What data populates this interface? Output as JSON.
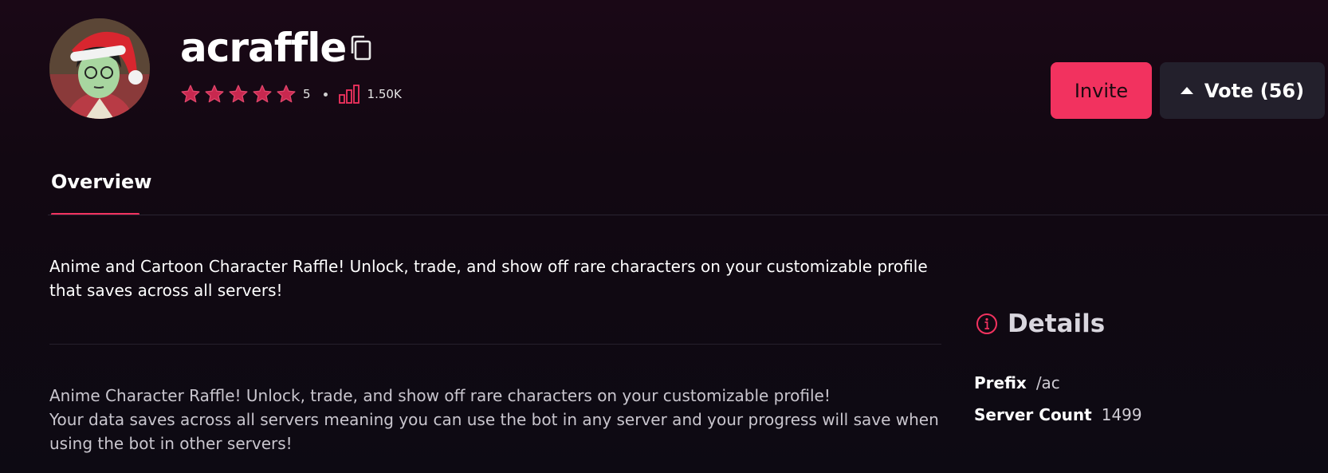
{
  "bot": {
    "name": "acraffle",
    "rating": "5",
    "star_count": 5,
    "server_stat": "1.50K"
  },
  "actions": {
    "invite_label": "Invite",
    "vote_label": "Vote (56)"
  },
  "tabs": [
    {
      "label": "Overview",
      "active": true
    }
  ],
  "description": {
    "short": "Anime and Cartoon Character Raffle! Unlock, trade, and show off rare characters on your customizable profile that saves across all servers!",
    "long_lines": [
      "Anime Character Raffle! Unlock, trade, and show off rare characters on your customizable profile!",
      "Your data saves across all servers meaning you can use the bot in any server and your progress will save when using the bot in other servers!"
    ]
  },
  "details": {
    "title": "Details",
    "prefix_label": "Prefix",
    "prefix_value": "/ac",
    "server_count_label": "Server Count",
    "server_count_value": "1499"
  },
  "colors": {
    "accent": "#f2325f",
    "vote_bg": "#23202c",
    "background": "#120812"
  },
  "icons": {
    "copy": "copy-icon",
    "star": "star-icon",
    "stats": "bar-chart-icon",
    "vote": "caret-up-icon",
    "info": "info-icon"
  }
}
